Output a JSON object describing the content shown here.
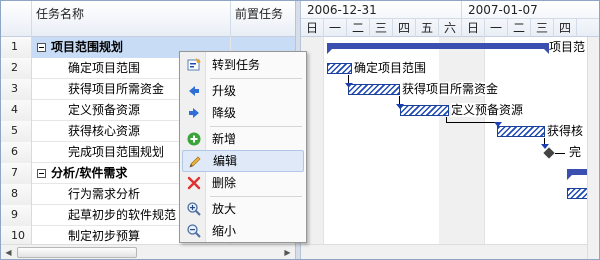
{
  "grid": {
    "headers": {
      "name": "任务名称",
      "predecessors": "前置任务"
    },
    "rows": [
      {
        "num": "1",
        "name": "项目范围规划",
        "group": true
      },
      {
        "num": "2",
        "name": "确定项目范围"
      },
      {
        "num": "3",
        "name": "获得项目所需资金"
      },
      {
        "num": "4",
        "name": "定义预备资源"
      },
      {
        "num": "5",
        "name": "获得核心资源"
      },
      {
        "num": "6",
        "name": "完成项目范围规划"
      },
      {
        "num": "7",
        "name": "分析/软件需求",
        "group": true
      },
      {
        "num": "8",
        "name": "行为需求分析"
      },
      {
        "num": "9",
        "name": "起草初步的软件规范"
      },
      {
        "num": "10",
        "name": "制定初步预算"
      }
    ]
  },
  "gantt": {
    "weeks": [
      "2006-12-31",
      "2007-01-07"
    ],
    "days": [
      "日",
      "一",
      "二",
      "三",
      "四",
      "五",
      "六",
      "日",
      "一",
      "二",
      "三",
      "四"
    ],
    "labels": {
      "summary1": "项目范",
      "task2": "确定项目范围",
      "task3": "获得项目所需资金",
      "task4": "定义预备资源",
      "task5": "获得核",
      "task6": "完"
    }
  },
  "context_menu": {
    "items": [
      {
        "label": "转到任务",
        "icon": "goto-task-icon"
      },
      {
        "label": "升级",
        "icon": "arrow-left-icon"
      },
      {
        "label": "降级",
        "icon": "arrow-right-icon"
      },
      {
        "label": "新增",
        "icon": "add-icon"
      },
      {
        "label": "编辑",
        "icon": "edit-icon"
      },
      {
        "label": "删除",
        "icon": "delete-icon"
      },
      {
        "label": "放大",
        "icon": "zoom-in-icon"
      },
      {
        "label": "缩小",
        "icon": "zoom-out-icon"
      }
    ],
    "highlighted": "编辑"
  },
  "colors": {
    "selection": "#c8dcf6",
    "bar": "#1e4bb8",
    "summary": "#3b4fb0"
  }
}
